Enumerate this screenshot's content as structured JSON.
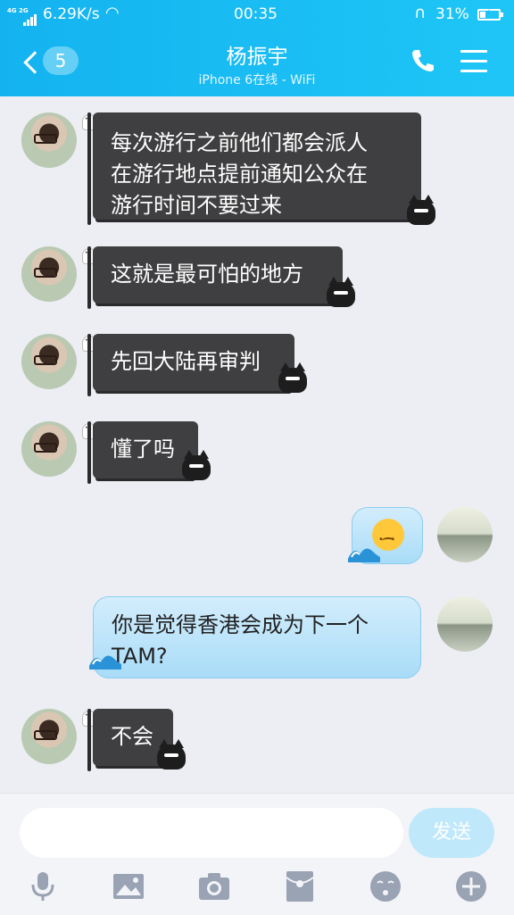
{
  "status_bar": {
    "network": "4G 2G",
    "speed": "6.29K/s",
    "time": "00:35",
    "battery": "31%",
    "battery_level": 0.31
  },
  "header": {
    "back_count": "5",
    "title": "杨振宇",
    "subtitle": "iPhone 6在线 - WiFi",
    "icons": [
      "back-chevron-icon",
      "phone-icon",
      "menu-icon"
    ]
  },
  "messages": [
    {
      "side": "left",
      "lines": [
        "每次游行之前他们都会派人",
        "在游行地点提前通知公众在",
        "游行时间不要过来"
      ]
    },
    {
      "side": "left",
      "lines": [
        "这就是最可怕的地方"
      ]
    },
    {
      "side": "left",
      "lines": [
        "先回大陆再审判"
      ]
    },
    {
      "side": "left",
      "lines": [
        "懂了吗"
      ]
    },
    {
      "side": "right",
      "emoji": "confused-face-emoji"
    },
    {
      "side": "right",
      "lines": [
        "你是觉得香港会成为下一个",
        "TAM?"
      ]
    },
    {
      "side": "left",
      "lines": [
        "不会"
      ]
    }
  ],
  "input_bar": {
    "placeholder": "",
    "send_label": "发送",
    "tool_icons": [
      "microphone-icon",
      "image-icon",
      "camera-icon",
      "red-envelope-icon",
      "emoji-icon",
      "plus-icon"
    ]
  },
  "colors": {
    "header": "#1ab8f2",
    "left_bubble": "#3f3f41",
    "right_bubble": "#bfe6fb",
    "send_button": "#bfe8fb"
  }
}
